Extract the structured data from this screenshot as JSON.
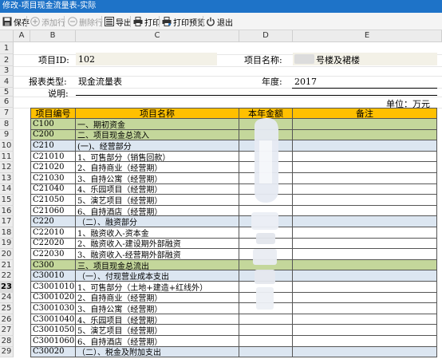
{
  "window": {
    "title": "修改-项目现金流量表-实际"
  },
  "toolbar": {
    "save": "保存",
    "add_row": "添加行",
    "delete_row": "删除行",
    "export": "导出",
    "print": "打印",
    "print_preview": "打印预览",
    "exit": "退出"
  },
  "columns": [
    "A",
    "B",
    "C",
    "D",
    "E"
  ],
  "rows": [
    "1",
    "2",
    "3",
    "4",
    "5",
    "6",
    "7",
    "8",
    "9",
    "10",
    "11",
    "12",
    "13",
    "14",
    "15",
    "16",
    "17",
    "18",
    "19",
    "20",
    "21",
    "22",
    "23",
    "24",
    "25",
    "26",
    "27",
    "28",
    "29"
  ],
  "selected_row": "23",
  "form": {
    "project_id_label": "项目ID:",
    "project_id_value": "102",
    "project_name_label": "项目名称:",
    "project_name_value": "号楼及裙楼",
    "report_type_label": "报表类型:",
    "report_type_value": "现金流量表",
    "year_label": "年度:",
    "year_value": "2017",
    "remark_label": "说明:",
    "unit_label": "单位：万元"
  },
  "table": {
    "headers": [
      "项目编号",
      "项目名称",
      "本年金额",
      "备注"
    ],
    "rows": [
      {
        "code": "C100",
        "name": "一、期初资金",
        "type": "section"
      },
      {
        "code": "C200",
        "name": "二、项目现金总流入",
        "type": "section"
      },
      {
        "code": "C210",
        "name": "(一)、经营部分",
        "type": "sub"
      },
      {
        "code": "C21010",
        "name": "1、可售部分（销售回款）",
        "type": "item"
      },
      {
        "code": "C21020",
        "name": "2、自持商业（经营期）",
        "type": "item"
      },
      {
        "code": "C21030",
        "name": "3、自持公寓（经营期）",
        "type": "item"
      },
      {
        "code": "C21040",
        "name": "4、乐园项目（经营期）",
        "type": "item"
      },
      {
        "code": "C21050",
        "name": "5、演艺项目（经营期）",
        "type": "item"
      },
      {
        "code": "C21060",
        "name": "6、自持酒店（经营期）",
        "type": "item"
      },
      {
        "code": "C220",
        "name": "（二）、融资部分",
        "type": "sub"
      },
      {
        "code": "C22010",
        "name": "1、融资收入-资本金",
        "type": "item"
      },
      {
        "code": "C22020",
        "name": "2、融资收入-建设期外部融资",
        "type": "item"
      },
      {
        "code": "C22030",
        "name": "3、融资收入-经营期外部融资",
        "type": "item"
      },
      {
        "code": "C300",
        "name": "三、项目现金总流出",
        "type": "section"
      },
      {
        "code": "C30010",
        "name": "（一）、付现营业成本支出",
        "type": "sub"
      },
      {
        "code": "C3001010",
        "name": "1、可售部分（土地+建造+红线外）",
        "type": "item"
      },
      {
        "code": "C3001020",
        "name": "2、自持商业（经营期）",
        "type": "item"
      },
      {
        "code": "C3001030",
        "name": "3、自持公寓（经营期）",
        "type": "item"
      },
      {
        "code": "C3001040",
        "name": "4、乐园项目（经营期）",
        "type": "item"
      },
      {
        "code": "C3001050",
        "name": "5、演艺项目（经营期）",
        "type": "item"
      },
      {
        "code": "C3001060",
        "name": "6、自持酒店（经营期）",
        "type": "item"
      },
      {
        "code": "C30020",
        "name": "（二）、税金及附加支出",
        "type": "sub"
      }
    ]
  },
  "colors": {
    "titlebar": "#1e73c8",
    "header_fill": "#ffc000",
    "section_fill": "#c4d79b",
    "sub_fill": "#dce6f1",
    "input_fill": "#f3f1e7"
  }
}
